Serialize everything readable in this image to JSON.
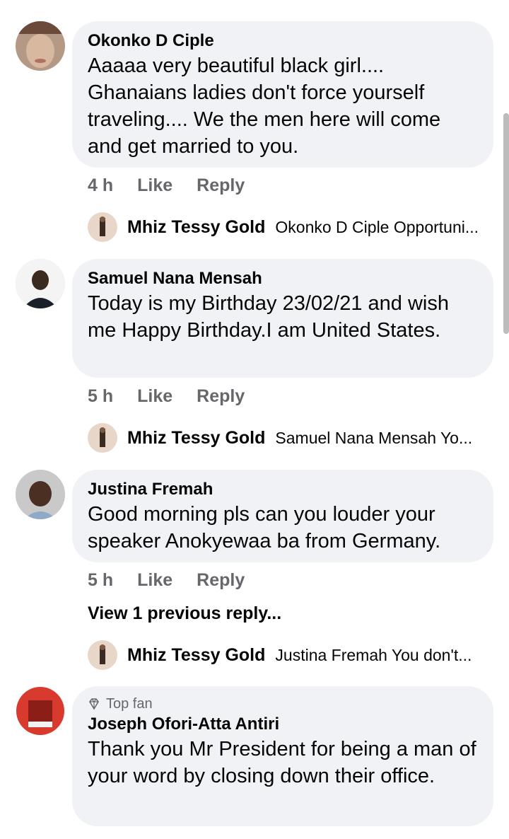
{
  "comments": [
    {
      "author": "Okonko D Ciple",
      "text": "Aaaaa very beautiful black girl.... Ghanaians ladies don't force yourself traveling.... We the men here will come and get married to you.",
      "time": "4 h",
      "like": "Like",
      "reply": "Reply",
      "reply_preview": {
        "author": "Mhiz Tessy Gold",
        "text": "Okonko D Ciple Opportuni..."
      }
    },
    {
      "author": "Samuel Nana Mensah",
      "text": "Today is my Birthday  23/02/21 and wish me Happy Birthday.I am United States.",
      "time": "5 h",
      "like": "Like",
      "reply": "Reply",
      "reply_preview": {
        "author": "Mhiz Tessy Gold",
        "text": "Samuel Nana Mensah Yo..."
      }
    },
    {
      "author": "Justina Fremah",
      "text": "Good morning pls can you louder your speaker Anokyewaa ba from Germany.",
      "time": "5 h",
      "like": "Like",
      "reply": "Reply",
      "view_previous": "View 1 previous reply...",
      "reply_preview": {
        "author": "Mhiz Tessy Gold",
        "text": "Justina Fremah You don't..."
      }
    },
    {
      "badge": "Top fan",
      "badge_icon": "diamond-icon",
      "author": "Joseph Ofori-Atta Antiri",
      "text": "Thank you Mr President for being a man of your word by closing down their office."
    }
  ]
}
